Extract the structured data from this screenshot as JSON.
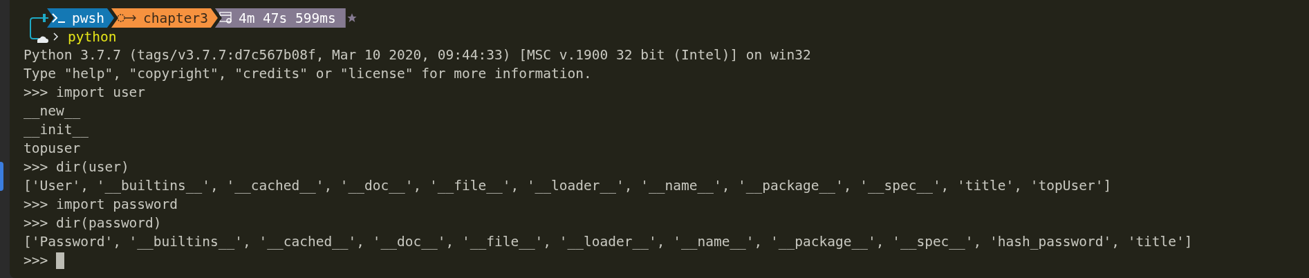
{
  "prompt": {
    "segments": [
      {
        "kind": "shell",
        "text": "pwsh",
        "color": "#1478b4"
      },
      {
        "kind": "folder",
        "text": "chapter3",
        "color": "#f6923f"
      },
      {
        "kind": "timer",
        "text": "4m 47s 599ms",
        "color": "#857a91"
      }
    ],
    "command": "python"
  },
  "lines": [
    "Python 3.7.7 (tags/v3.7.7:d7c567b08f, Mar 10 2020, 09:44:33) [MSC v.1900 32 bit (Intel)] on win32",
    "Type \"help\", \"copyright\", \"credits\" or \"license\" for more information.",
    ">>> import user",
    "__new__",
    "__init__",
    "topuser",
    ">>> dir(user)",
    "['User', '__builtins__', '__cached__', '__doc__', '__file__', '__loader__', '__name__', '__package__', '__spec__', 'title', 'topUser']",
    ">>> import password",
    ">>> dir(password)",
    "['Password', '__builtins__', '__cached__', '__doc__', '__file__', '__loader__', '__name__', '__package__', '__spec__', 'hash_password', 'title']"
  ],
  "input": {
    "prompt": ">>>"
  }
}
